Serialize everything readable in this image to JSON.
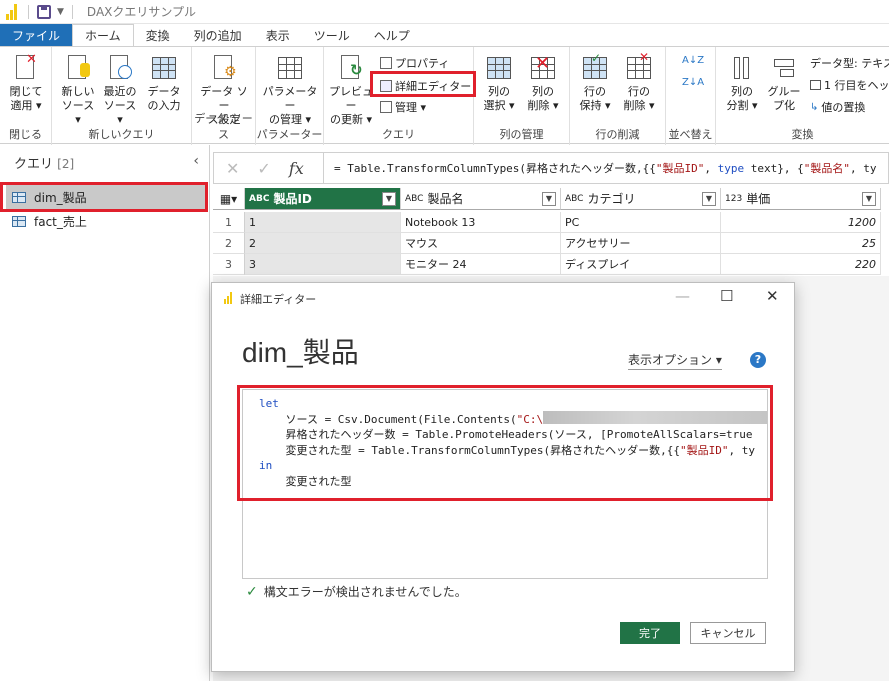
{
  "app": {
    "title": "DAXクエリサンプル"
  },
  "tabs": [
    "ファイル",
    "ホーム",
    "変換",
    "列の追加",
    "表示",
    "ツール",
    "ヘルプ"
  ],
  "ribbon": {
    "close_apply": [
      "閉じて",
      "適用 ▾"
    ],
    "group_close": "閉じる",
    "new_source": [
      "新しい",
      "ソース ▾"
    ],
    "recent_source": [
      "最近の",
      "ソース ▾"
    ],
    "enter_data": [
      "データ",
      "の入力"
    ],
    "group_new_query": "新しいクエリ",
    "datasource_settings": [
      "データ ソー",
      "ス設定"
    ],
    "group_datasource": "データ ソース",
    "manage_params": [
      "パラメーター",
      "の管理 ▾"
    ],
    "group_params": "パラメーター",
    "preview_refresh": [
      "プレビュー",
      "の更新 ▾"
    ],
    "properties": "プロパティ",
    "advanced_editor": "詳細エディター",
    "manage": "管理 ▾",
    "group_query": "クエリ",
    "choose_columns": [
      "列の",
      "選択 ▾"
    ],
    "remove_columns": [
      "列の",
      "削除 ▾"
    ],
    "group_manage_columns": "列の管理",
    "keep_rows": [
      "行の",
      "保持 ▾"
    ],
    "remove_rows": [
      "行の",
      "削除 ▾"
    ],
    "group_reduce_rows": "行の削減",
    "group_sort": "並べ替え",
    "split_column": [
      "列の",
      "分割 ▾"
    ],
    "group_by": [
      "グルー",
      "プ化"
    ],
    "datatype": "データ型: テキスト",
    "first_row_header": "1 行目をヘッ",
    "replace_values": "値の置換",
    "group_transform": "変換"
  },
  "queries": {
    "header": "クエリ",
    "count": "[2]",
    "items": [
      "dim_製品",
      "fact_売上"
    ]
  },
  "formula": {
    "text_prefix": "= Table.TransformColumnTypes(昇格されたヘッダー数,{{",
    "str1": "\"製品ID\"",
    "mid1": ", ",
    "kw1": "type",
    "mid2": " text}, {",
    "str2": "\"製品名\"",
    "tail": ", ty"
  },
  "grid": {
    "columns": [
      {
        "type": "ABC",
        "name": "製品ID"
      },
      {
        "type": "ABC",
        "name": "製品名"
      },
      {
        "type": "ABC",
        "name": "カテゴリ"
      },
      {
        "type": "123",
        "name": "単価"
      }
    ],
    "rows": [
      [
        "1",
        "1",
        "Notebook 13",
        "PC",
        "1200"
      ],
      [
        "2",
        "2",
        "マウス",
        "アクセサリー",
        "25"
      ],
      [
        "3",
        "3",
        "モニター 24",
        "ディスプレイ",
        "220"
      ]
    ]
  },
  "dialog": {
    "title": "詳細エディター",
    "heading": "dim_製品",
    "display_options": "表示オプション ▾",
    "help": "?",
    "code": {
      "l1": "let",
      "l2a": "    ソース = Csv.Document(File.Contents(",
      "l2s": "\"C:\\",
      "l3": "    昇格されたヘッダー数 = Table.PromoteHeaders(ソース, [PromoteAllScalars=true",
      "l4a": "    変更された型 = Table.TransformColumnTypes(昇格されたヘッダー数,{{",
      "l4s": "\"製品ID\"",
      "l4b": ", ty",
      "l5": "in",
      "l6": "    変更された型"
    },
    "status": "構文エラーが検出されませんでした。",
    "done": "完了",
    "cancel": "キャンセル"
  },
  "colors": {
    "accent_green": "#217346",
    "file_tab": "#1f6fb7",
    "highlight_red": "#e0202c"
  }
}
